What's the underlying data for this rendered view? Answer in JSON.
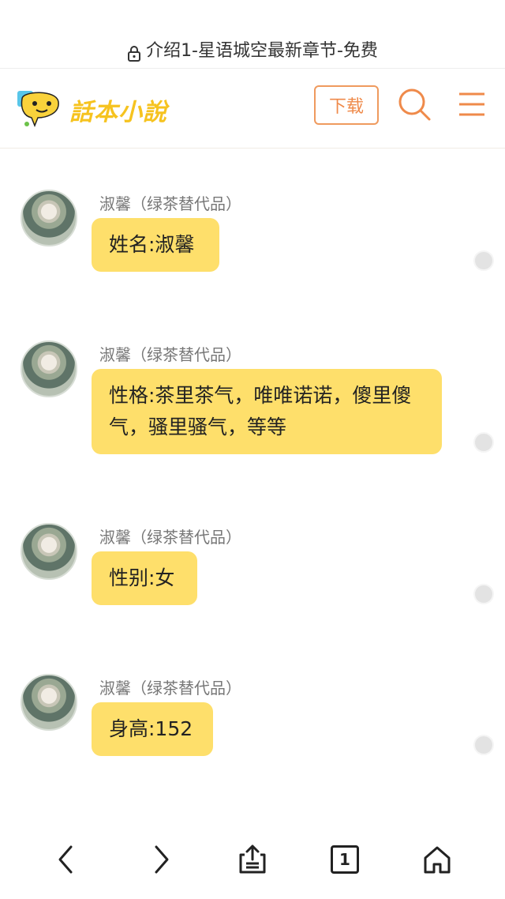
{
  "url_bar": {
    "title": "介绍1-星语城空最新章节-免费"
  },
  "site_header": {
    "logo_text": "話本小說",
    "download_label": "下载"
  },
  "messages": [
    {
      "name": "淑馨（绿茶替代品）",
      "text": "姓名:淑馨"
    },
    {
      "name": "淑馨（绿茶替代品）",
      "text": "性格:茶里茶气，唯唯诺诺，傻里傻气，骚里骚气，等等"
    },
    {
      "name": "淑馨（绿茶替代品）",
      "text": "性别:女"
    },
    {
      "name": "淑馨（绿茶替代品）",
      "text": "身高:152"
    }
  ],
  "bottom_bar": {
    "tab_count": "1",
    "icons": [
      "back-icon",
      "forward-icon",
      "share-icon",
      "tabs-icon",
      "home-icon"
    ]
  },
  "colors": {
    "bubble": "#fedf6b",
    "accent": "#ef8a4a",
    "logo": "#f6c31f"
  }
}
